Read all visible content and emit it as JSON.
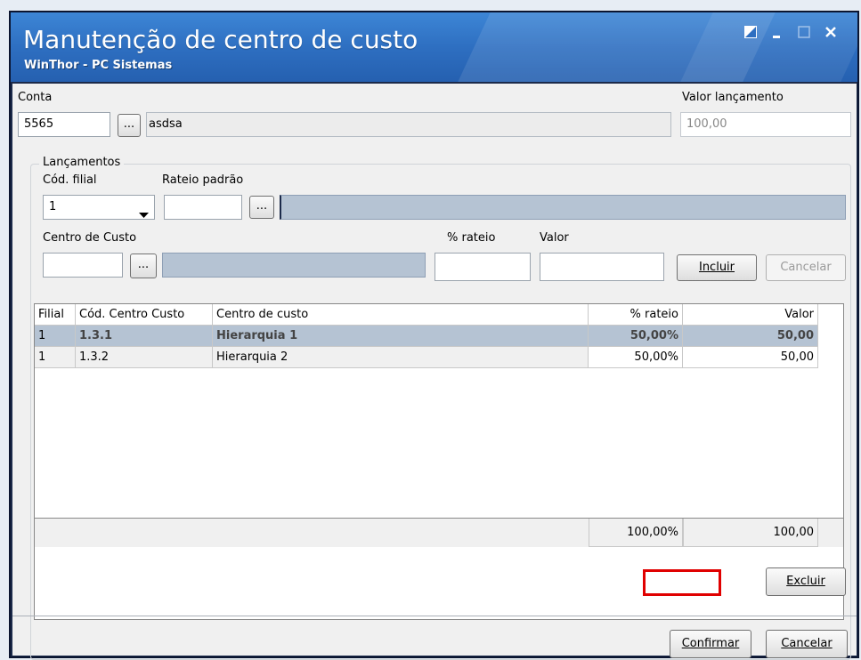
{
  "window": {
    "title": "Manutenção de centro de custo",
    "subtitle": "WinThor - PC Sistemas",
    "controls": [
      "restore-icon",
      "minimize-icon",
      "maximize-icon",
      "close-icon"
    ]
  },
  "conta": {
    "label": "Conta",
    "code": "5565",
    "lookup_label": "...",
    "description": "asdsa"
  },
  "valor_lancamento": {
    "label": "Valor lançamento",
    "value": "100,00"
  },
  "lancamentos": {
    "group_label": "Lançamentos",
    "cod_filial_label": "Cód. filial",
    "cod_filial_value": "1",
    "rateio_padrao_label": "Rateio padrão",
    "rateio_padrao_value": "",
    "rateio_lookup_label": "...",
    "centro_custo_label": "Centro de Custo",
    "centro_custo_value": "",
    "centro_lookup_label": "...",
    "pct_rateio_label": "% rateio",
    "pct_rateio_value": "",
    "valor_label": "Valor",
    "valor_value": "",
    "incluir_label": "Incluir",
    "cancelar_label": "Cancelar"
  },
  "grid": {
    "headers": [
      "Filial",
      "Cód. Centro Custo",
      "Centro de custo",
      "% rateio",
      "Valor"
    ],
    "rows": [
      {
        "filial": "1",
        "cod": "1.3.1",
        "centro": "Hierarquia 1",
        "pct": "50,00%",
        "valor": "50,00"
      },
      {
        "filial": "1",
        "cod": "1.3.2",
        "centro": "Hierarquia 2",
        "pct": "50,00%",
        "valor": "50,00"
      }
    ],
    "total_pct": "100,00%",
    "total_valor": "100,00"
  },
  "actions": {
    "excluir_label": "Excluir",
    "confirmar_label": "Confirmar",
    "cancelar_label": "Cancelar"
  },
  "colors": {
    "title_bar": "#2e6fc1",
    "selected_row": "#b5c3d3",
    "highlight_box": "#e00000"
  }
}
